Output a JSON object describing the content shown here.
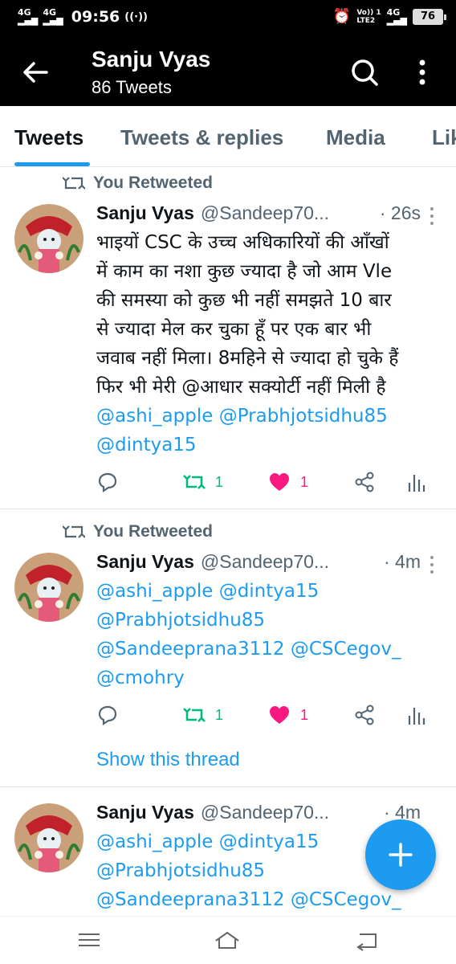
{
  "status_bar": {
    "network_left_1": "4G",
    "network_left_2": "4G",
    "time": "09:56",
    "hotspot": "((·))",
    "alarm": "⏰",
    "volte_top": "Vo)) 1",
    "volte_bottom": "LTE2",
    "network_right": "4G",
    "battery": "76"
  },
  "header": {
    "title": "Sanju Vyas",
    "subtitle": "86 Tweets",
    "icons": [
      "back-arrow-icon",
      "search-icon",
      "more-vertical-icon"
    ]
  },
  "tabs": [
    {
      "label": "Tweets",
      "active": true
    },
    {
      "label": "Tweets & replies",
      "active": false
    },
    {
      "label": "Media",
      "active": false
    },
    {
      "label": "Lik",
      "active": false
    }
  ],
  "tweets": [
    {
      "retweet_label": "You Retweeted",
      "name": "Sanju Vyas",
      "handle": "@Sandeep70...",
      "time": "· 26s",
      "lines": [
        "भाइयों CSC के उच्च अधिकारियों की आँखों",
        "में काम का नशा कुछ ज्यादा है जो आम Vle",
        "की समस्या को कुछ भी नहीं समझते 10 बार",
        "से ज्यादा मेल कर चुका हूँ पर एक बार भी",
        "जवाब नहीं मिला। 8महिने से ज्यादा हो चुके हैं",
        "फिर भी मेरी @आधार सक्योर्टी नहीं  मिली है"
      ],
      "mention_lines": [
        "@ashi_apple @Prabhjotsidhu85",
        "@dintya15"
      ],
      "retweets": "1",
      "likes": "1"
    },
    {
      "retweet_label": "You Retweeted",
      "name": "Sanju Vyas",
      "handle": "@Sandeep70...",
      "time": "· 4m",
      "mention_lines": [
        "@ashi_apple @dintya15",
        "@Prabhjotsidhu85",
        "@Sandeeprana3112 @CSCegov_",
        "@cmohry"
      ],
      "retweets": "1",
      "likes": "1",
      "show_thread": "Show this thread"
    },
    {
      "name": "Sanju Vyas",
      "handle": "@Sandeep70...",
      "time": "· 4m",
      "mention_lines": [
        "@ashi_apple @dintya15",
        "@Prabhjotsidhu85",
        "@Sandeeprana3112 @CSCegov_"
      ]
    }
  ],
  "fab_icon": "plus-icon",
  "nav_icons": [
    "menu-icon",
    "home-icon",
    "back-icon"
  ],
  "colors": {
    "accent": "#1d9bf0",
    "retweet": "#00ba7c",
    "like": "#f91880",
    "secondary": "#536471"
  }
}
